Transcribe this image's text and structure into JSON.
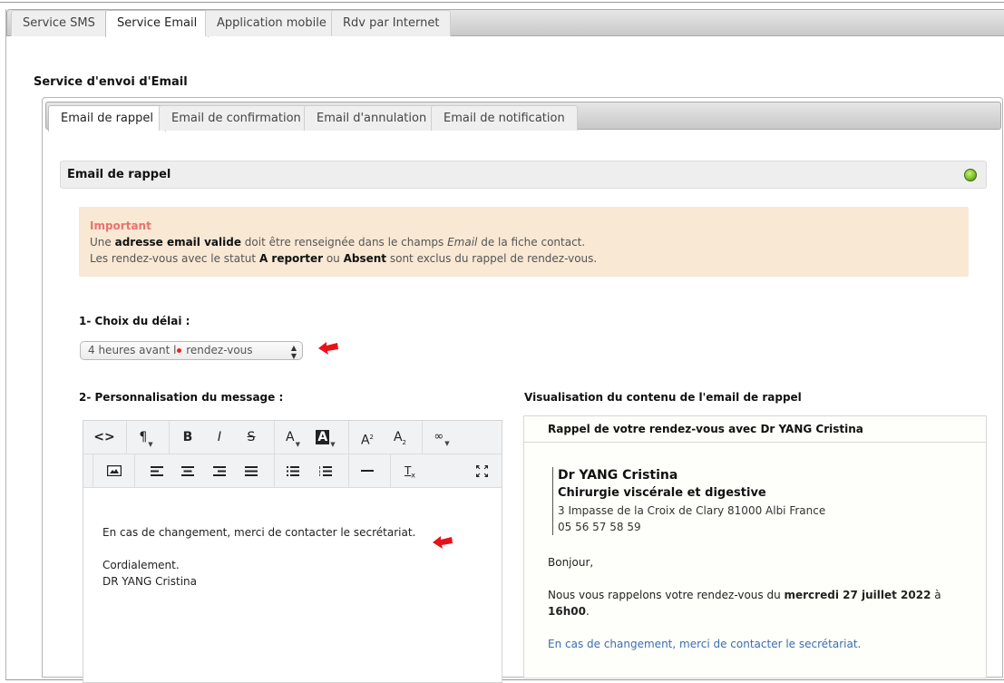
{
  "outer_tabs": [
    {
      "label": "Service SMS",
      "active": false
    },
    {
      "label": "Service Email",
      "active": true
    },
    {
      "label": "Application mobile",
      "active": false
    },
    {
      "label": "Rdv par Internet",
      "active": false
    }
  ],
  "section_title": "Service d'envoi d'Email",
  "inner_tabs": [
    {
      "label": "Email de rappel",
      "active": true
    },
    {
      "label": "Email de confirmation",
      "active": false
    },
    {
      "label": "Email d'annulation",
      "active": false
    },
    {
      "label": "Email de notification",
      "active": false
    }
  ],
  "panel": {
    "title": "Email de rappel",
    "status_icon": "green-status-led",
    "status_color": "#7fc22c"
  },
  "alert": {
    "title": "Important",
    "line1_pre": "Une ",
    "line1_bold": "adresse email valide",
    "line1_mid": " doit être renseignée dans le champs ",
    "line1_italic": "Email",
    "line1_post": " de la fiche contact.",
    "line2_pre": "Les rendez-vous avec le statut ",
    "line2_bold1": "A reporter",
    "line2_mid": " ou ",
    "line2_bold2": "Absent",
    "line2_post": " sont exclus du rappel de rendez-vous.",
    "title_color": "#e8736e",
    "background": "#f8e8d4"
  },
  "step1": {
    "label": "1- Choix du délai :",
    "select_value_pre": "4 heures avant l",
    "select_value_post": " rendez-vous",
    "select_full_value": "4 heures avant le rendez-vous"
  },
  "step2": {
    "label": "2- Personnalisation du message :"
  },
  "editor": {
    "toolbar_row1": [
      {
        "icon": "code-view-icon",
        "glyph": "<>"
      },
      {
        "icon": "paragraph-format-icon",
        "glyph": "¶"
      },
      {
        "icon": "bold-icon",
        "glyph": "B"
      },
      {
        "icon": "italic-icon",
        "glyph": "I"
      },
      {
        "icon": "strikethrough-icon",
        "glyph": "S"
      },
      {
        "icon": "text-color-icon",
        "glyph": "A"
      },
      {
        "icon": "background-color-icon",
        "glyph": "A"
      },
      {
        "icon": "superscript-icon",
        "glyph": "A²"
      },
      {
        "icon": "subscript-icon",
        "glyph": "A₂"
      },
      {
        "icon": "link-icon",
        "glyph": "🔗"
      }
    ],
    "toolbar_row2": [
      {
        "icon": "insert-image-icon"
      },
      {
        "icon": "align-left-icon",
        "glyph": "≡"
      },
      {
        "icon": "align-center-icon",
        "glyph": "≡"
      },
      {
        "icon": "align-right-icon",
        "glyph": "≡"
      },
      {
        "icon": "justify-icon",
        "glyph": "≡"
      },
      {
        "icon": "bulleted-list-icon",
        "glyph": "⁝≡"
      },
      {
        "icon": "numbered-list-icon",
        "glyph": "⁝≡"
      },
      {
        "icon": "horizontal-rule-icon",
        "glyph": "—"
      },
      {
        "icon": "clear-formatting-icon",
        "glyph": "Tx"
      },
      {
        "icon": "fullscreen-icon",
        "glyph": "⤢"
      }
    ],
    "content": {
      "line1": "En cas de changement, merci de contacter le secrétariat.",
      "line2": "Cordialement.",
      "line3": "DR YANG Cristina"
    }
  },
  "preview": {
    "title": "Visualisation du contenu de l'email de rappel",
    "subject": "Rappel de votre rendez-vous avec Dr YANG Cristina",
    "signature": {
      "name": "Dr YANG Cristina",
      "specialty": "Chirurgie viscérale et digestive",
      "address": "3 Impasse de la Croix de Clary 81000 Albi France",
      "phone": "05 56 57 58 59"
    },
    "greeting": "Bonjour,",
    "body_pre": "Nous vous rappelons votre rendez-vous du ",
    "body_date": "mercredi 27 juillet 2022",
    "body_mid": " à ",
    "body_time": "16h00",
    "body_post": ".",
    "custom_message": "En cas de changement, merci de contacter le secrétariat.",
    "link_color": "#3a6fb0"
  },
  "annotations": {
    "arrow_color": "#e8121a"
  }
}
